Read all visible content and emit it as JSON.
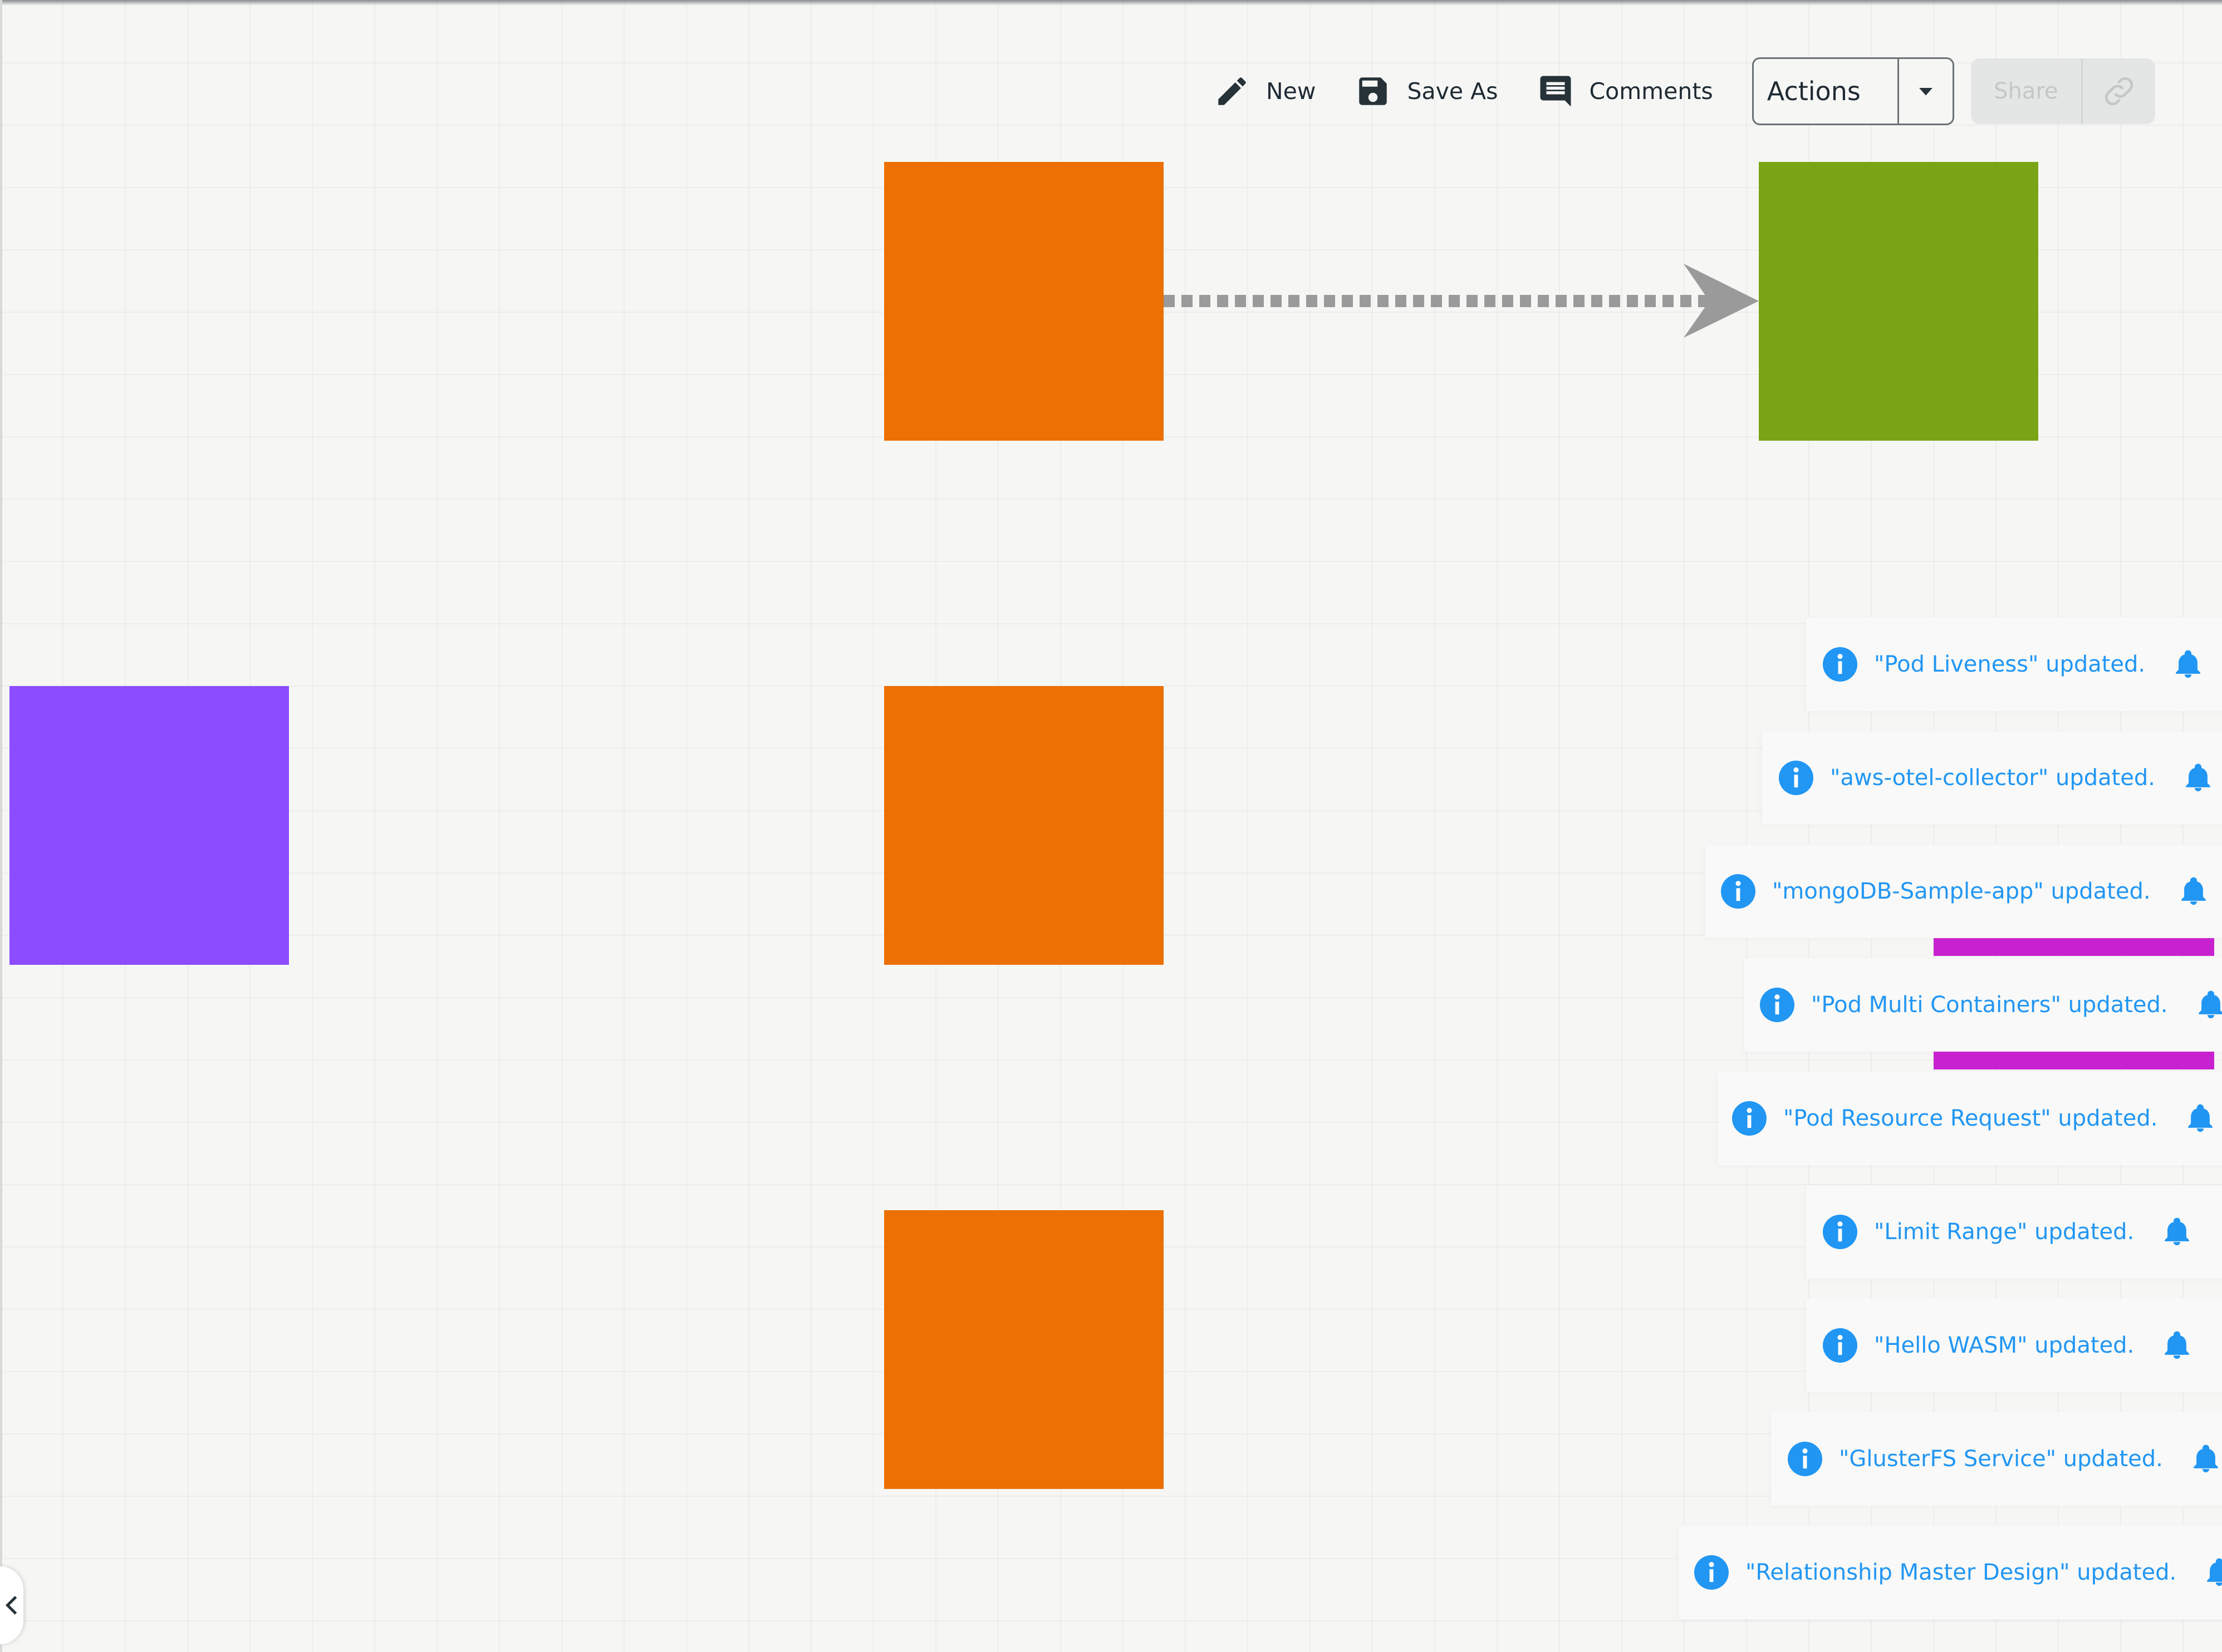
{
  "toolbar": {
    "new_label": "New",
    "save_as_label": "Save As",
    "comments_label": "Comments",
    "actions_label": "Actions",
    "share_label": "Share"
  },
  "diagram": {
    "colors": {
      "orange": "#ec7003",
      "green": "#7ba316",
      "purple": "#8c4cff",
      "edge": "#9a9a9a"
    }
  },
  "notifications": [
    {
      "message": "\"Pod Liveness\" updated."
    },
    {
      "message": "\"aws-otel-collector\" updated."
    },
    {
      "message": "\"mongoDB-Sample-app\" updated."
    },
    {
      "message": "\"Pod Multi Containers\" updated."
    },
    {
      "message": "\"Pod Resource Request\" updated."
    },
    {
      "message": "\"Limit Range\" updated."
    },
    {
      "message": "\"Hello WASM\" updated."
    },
    {
      "message": "\"GlusterFS Service\" updated."
    },
    {
      "message": "\"Relationship Master Design\" updated."
    }
  ],
  "colors": {
    "accent": "#2196f3",
    "progress": "#c822d0"
  }
}
